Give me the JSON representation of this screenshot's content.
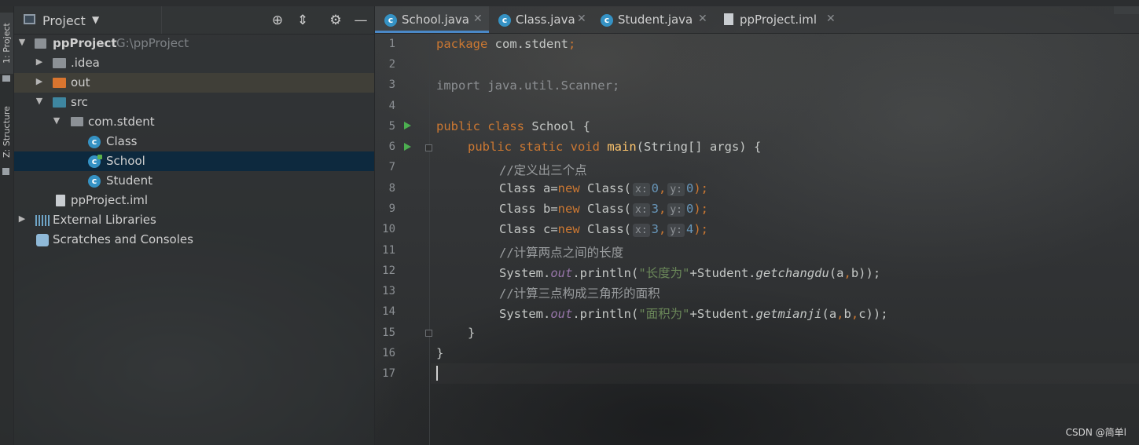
{
  "toolstrip": {
    "project_tab": "1: Project",
    "structure_tab": "Z: Structure"
  },
  "project_panel": {
    "title": "Project",
    "tree": [
      {
        "label": "ppProject",
        "hint": "G:\\ppProject"
      },
      {
        "label": ".idea"
      },
      {
        "label": "out"
      },
      {
        "label": "src"
      },
      {
        "label": "com.stdent"
      },
      {
        "label": "Class"
      },
      {
        "label": "School"
      },
      {
        "label": "Student"
      },
      {
        "label": "ppProject.iml"
      },
      {
        "label": "External Libraries"
      },
      {
        "label": "Scratches and Consoles"
      }
    ]
  },
  "tabs": [
    {
      "label": "School.java",
      "active": true
    },
    {
      "label": "Class.java"
    },
    {
      "label": "Student.java"
    },
    {
      "label": "ppProject.iml"
    }
  ],
  "editor": {
    "line_numbers": [
      "1",
      "2",
      "3",
      "4",
      "5",
      "6",
      "7",
      "8",
      "9",
      "10",
      "11",
      "12",
      "13",
      "14",
      "15",
      "16",
      "17"
    ],
    "lines": {
      "l1_kw": "package",
      "l1_rest": " com.stdent",
      "l1_semi": ";",
      "l3": "import java.util.Scanner;",
      "l5_kw": "public class",
      "l5_rest": " School {",
      "l6_kw": "public static void",
      "l6_fn": "main",
      "l6_rest": "(String[] args) {",
      "l7": "//定义出三个点",
      "l8_a": "Class a=",
      "l8_b": "Class(",
      "l8_x": "0",
      "l8_y": "0",
      "l9_a": "Class b=",
      "l9_b": "Class(",
      "l9_x": "3",
      "l9_y": "0",
      "l10_a": "Class c=",
      "l10_b": "Class(",
      "l10_x": "3",
      "l10_y": "4",
      "l11": "//计算两点之间的长度",
      "l12_a": "System.",
      "l12_out": "out",
      "l12_b": ".println(",
      "l12_str": "\"长度为\"",
      "l12_c": "+Student.",
      "l12_m": "getchangdu",
      "l12_d": "(a",
      "l12_e": "b));",
      "l13": "//计算三点构成三角形的面积",
      "l14_a": "System.",
      "l14_out": "out",
      "l14_b": ".println(",
      "l14_str": "\"面积为\"",
      "l14_c": "+Student.",
      "l14_m": "getmianji",
      "l14_d": "(a",
      "l14_e": "b",
      "l14_f": "c));",
      "l15": "}",
      "l16": "}",
      "kw_new": "new",
      "hint_x": "x:",
      "hint_y": "y:",
      "comma": ",",
      "close": ");"
    }
  },
  "watermark": "CSDN @简单l"
}
